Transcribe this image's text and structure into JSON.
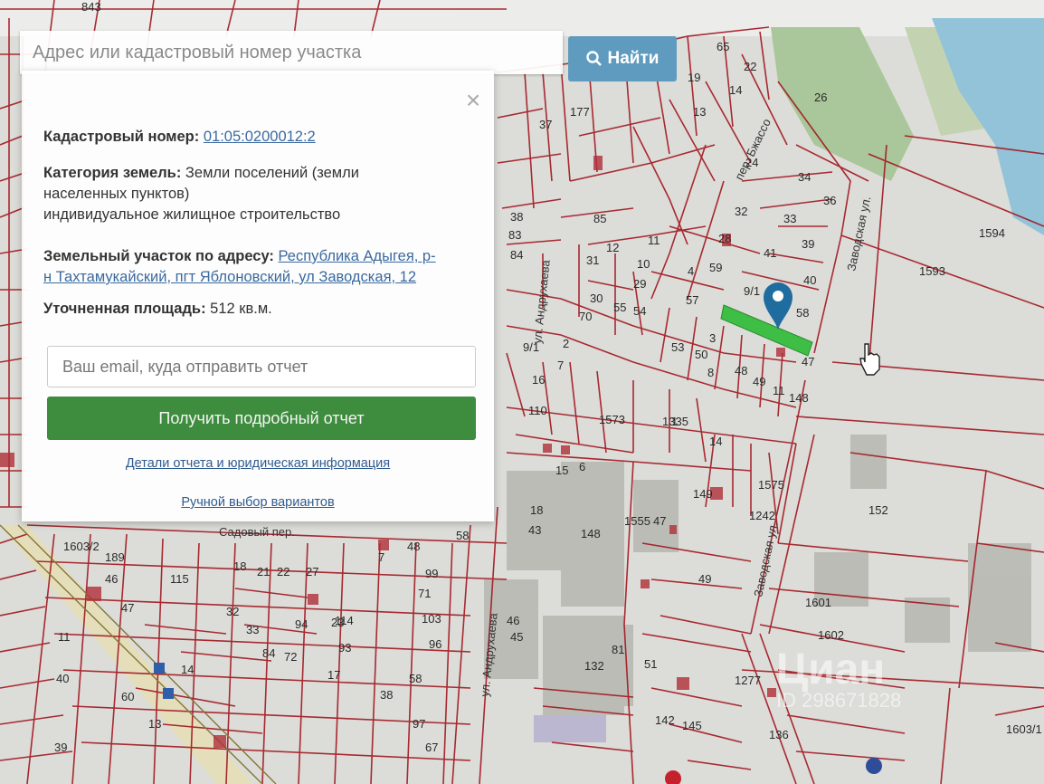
{
  "search": {
    "placeholder": "Адрес или кадастровый номер участка",
    "button_label": "Найти"
  },
  "panel": {
    "close_symbol": "×",
    "cadastral_label": "Кадастровый номер:",
    "cadastral_value": "01:05:0200012:2",
    "category_label": "Категория земель:",
    "category_value_1": "Земли поселений (земли",
    "category_value_2": "населенных пунктов)",
    "category_value_3": "индивидуальное жилищное строительство",
    "address_label": "Земельный участок по адресу:",
    "address_value_1": "Республика Адыгея, р-",
    "address_value_2": "н Тахтамукайский, пгт Яблоновский, ул Заводская, 12",
    "area_label": "Уточненная площадь:",
    "area_value": "512 кв.м.",
    "email_placeholder": "Ваш email, куда отправить отчет",
    "report_button": "Получить подробный отчет",
    "details_link": "Детали отчета и юридическая информация",
    "manual_link": "Ручной выбор вариантов"
  },
  "map": {
    "streets": [
      "ул. Андрухаева",
      "Садовый пер.",
      "Заводская ул.",
      "пер. Бжассо"
    ],
    "parcel_numbers": [
      "843",
      "65",
      "22",
      "26",
      "1594",
      "1593",
      "19",
      "13",
      "37",
      "177",
      "14",
      "24",
      "34",
      "36",
      "38",
      "83",
      "84",
      "85",
      "12",
      "11",
      "28",
      "32",
      "33",
      "39",
      "40",
      "41",
      "59",
      "4",
      "9/1",
      "58",
      "57",
      "31",
      "10",
      "29",
      "30",
      "55",
      "54",
      "53",
      "50",
      "49",
      "48",
      "47",
      "16",
      "1573",
      "1335",
      "14",
      "11",
      "148",
      "149",
      "1575",
      "1242",
      "18",
      "43",
      "148",
      "1555",
      "47",
      "49",
      "152",
      "1601",
      "1602",
      "1603/1",
      "1603/2",
      "189",
      "46",
      "47",
      "48",
      "99",
      "71",
      "103",
      "96",
      "93",
      "58",
      "115",
      "18",
      "21",
      "22",
      "27",
      "7",
      "33",
      "32",
      "94",
      "114",
      "84",
      "72",
      "46",
      "45",
      "132",
      "81",
      "51",
      "1277",
      "136",
      "142",
      "145",
      "58",
      "38",
      "97",
      "67",
      "60",
      "13",
      "14",
      "39",
      "40",
      "11",
      "17",
      "23",
      "110",
      "9/1",
      "70",
      "2",
      "7",
      "8",
      "3",
      "1",
      "15",
      "6",
      "5",
      "47",
      "56"
    ],
    "watermark_1": "Циан",
    "watermark_2": "ID 298671828"
  },
  "colors": {
    "parcel_line": "#a2161f",
    "highlight": "#3fbe45",
    "marker": "#1f6c9e",
    "button_green": "#3e8d3e",
    "button_blue": "#5e9bbf"
  }
}
